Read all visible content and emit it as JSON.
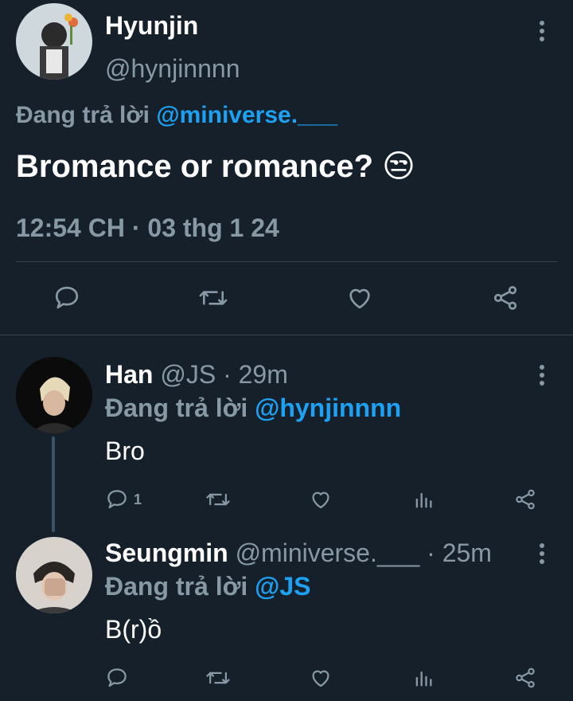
{
  "tweet": {
    "author_name": "Hyunjin",
    "handle": "@hynjinnnn",
    "reply_prefix": "Đang trả lời",
    "reply_to": "@miniverse.___",
    "text": "Bromance or romance?",
    "emoji": "😒",
    "timestamp": "12:54 CH · 03 thg 1 24"
  },
  "replies": [
    {
      "name": "Han",
      "handle": "@JS",
      "time": "· 29m",
      "reply_prefix": "Đang trả lời",
      "reply_to": "@hynjinnnn",
      "text": "Bro",
      "reply_count": "1"
    },
    {
      "name": "Seungmin",
      "handle": "@miniverse.___",
      "time": "· 25m",
      "reply_prefix": "Đang trả lời",
      "reply_to": "@JS",
      "text": "B(r)ồ",
      "reply_count": ""
    }
  ],
  "icons": {
    "reply": "comment-icon",
    "retweet": "retweet-icon",
    "like": "heart-icon",
    "analytics": "analytics-icon",
    "share": "share-icon",
    "more": "more-vertical-icon"
  },
  "colors": {
    "background": "#15202b",
    "link": "#1da1f2",
    "muted": "#8899a6"
  }
}
